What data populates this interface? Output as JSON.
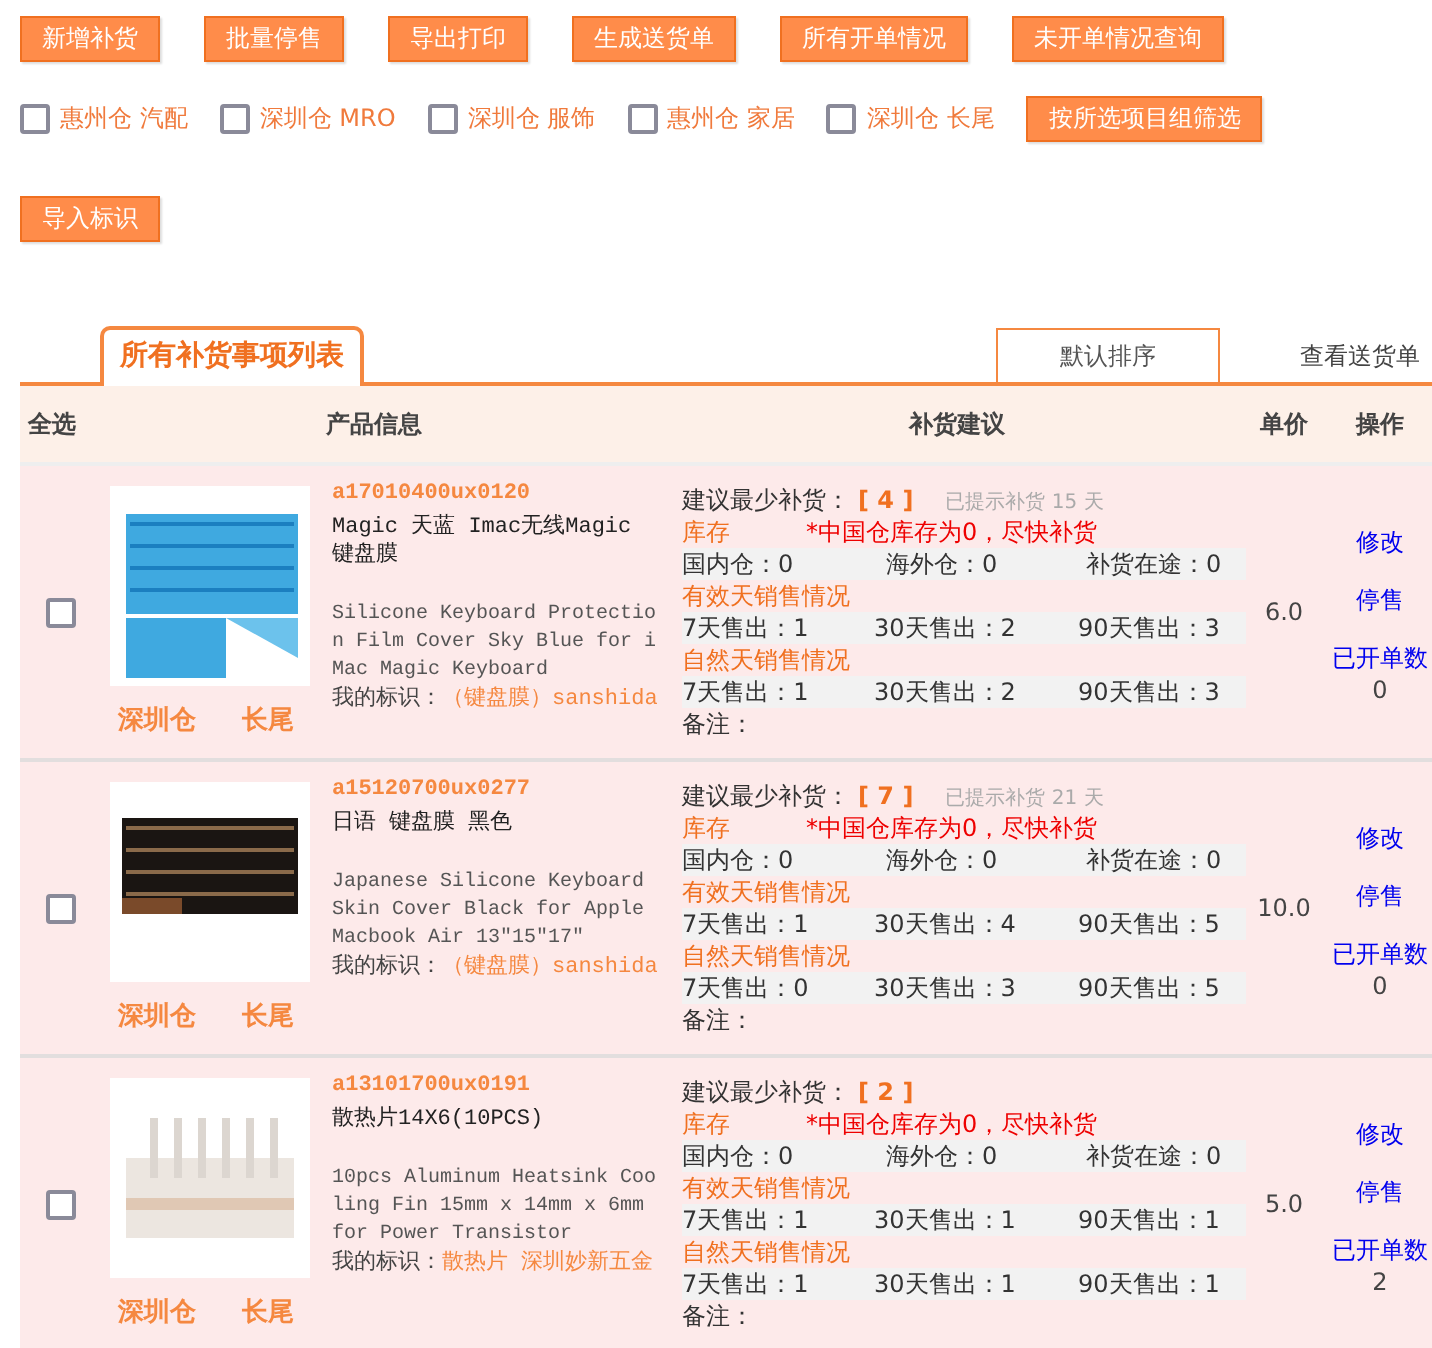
{
  "toolbar": [
    "新增补货",
    "批量停售",
    "导出打印",
    "生成送货单",
    "所有开单情况",
    "未开单情况查询"
  ],
  "filters": [
    {
      "label": "惠州仓 汽配",
      "checked": false
    },
    {
      "label": "深圳仓 MRO",
      "checked": false
    },
    {
      "label": "深圳仓 服饰",
      "checked": false
    },
    {
      "label": "惠州仓 家居",
      "checked": false
    },
    {
      "label": "深圳仓 长尾",
      "checked": false
    }
  ],
  "filter_button": "按所选项目组筛选",
  "import_button": "导入标识",
  "tab": {
    "label": "所有补货事项列表",
    "selected": true
  },
  "sort_button": "默认排序",
  "delivery_link": "查看送货单",
  "columns": [
    "全选",
    "产品信息",
    "补货建议",
    "单价",
    "操作"
  ],
  "rows": [
    {
      "checked": false,
      "warehouse": "深圳仓",
      "group": "长尾",
      "sku": "a17010400ux0120",
      "title": "Magic 天蓝 Imac无线Magic 键盘膜",
      "description": "Silicone Keyboard Protection Film Cover Sky Blue for iMac Magic Keyboard",
      "tag_label": "我的标识：",
      "tag": "（键盘膜）sanshida",
      "suggest_label": "建议最少补货：",
      "suggest_qty": "[ 4 ]",
      "reminder": "已提示补货 15 天",
      "stock_label": "库存",
      "warning": "*中国仓库存为0，尽快补货",
      "stock": [
        "国内仓：0",
        "海外仓：0",
        "补货在途：0"
      ],
      "effective_label": "有效天销售情况",
      "effective": [
        "7天售出：1",
        "30天售出：2",
        "90天售出：3"
      ],
      "natural_label": "自然天销售情况",
      "natural": [
        "7天售出：1",
        "30天售出：2",
        "90天售出：3"
      ],
      "note": "备注：",
      "price": "6.0",
      "actions": [
        "修改",
        "停售",
        "已开单数"
      ],
      "order_count": "0"
    },
    {
      "checked": false,
      "warehouse": "深圳仓",
      "group": "长尾",
      "sku": "a15120700ux0277",
      "title": "日语 键盘膜 黑色",
      "description": "Japanese Silicone Keyboard Skin Cover Black for Apple Macbook Air 13\"15\"17\"",
      "tag_label": "我的标识：",
      "tag": "（键盘膜）sanshida",
      "suggest_label": "建议最少补货：",
      "suggest_qty": "[ 7 ]",
      "reminder": "已提示补货 21 天",
      "stock_label": "库存",
      "warning": "*中国仓库存为0，尽快补货",
      "stock": [
        "国内仓：0",
        "海外仓：0",
        "补货在途：0"
      ],
      "effective_label": "有效天销售情况",
      "effective": [
        "7天售出：1",
        "30天售出：4",
        "90天售出：5"
      ],
      "natural_label": "自然天销售情况",
      "natural": [
        "7天售出：0",
        "30天售出：3",
        "90天售出：5"
      ],
      "note": "备注：",
      "price": "10.0",
      "actions": [
        "修改",
        "停售",
        "已开单数"
      ],
      "order_count": "0"
    },
    {
      "checked": false,
      "warehouse": "深圳仓",
      "group": "长尾",
      "sku": "a13101700ux0191",
      "title": "散热片14X6(10PCS)",
      "description": "10pcs Aluminum Heatsink Cooling Fin 15mm x 14mm x 6mm for Power Transistor",
      "tag_label": "我的标识：",
      "tag": "散热片 深圳妙新五金",
      "suggest_label": "建议最少补货：",
      "suggest_qty": "[ 2 ]",
      "reminder": "",
      "stock_label": "库存",
      "warning": "*中国仓库存为0，尽快补货",
      "stock": [
        "国内仓：0",
        "海外仓：0",
        "补货在途：0"
      ],
      "effective_label": "有效天销售情况",
      "effective": [
        "7天售出：1",
        "30天售出：1",
        "90天售出：1"
      ],
      "natural_label": "自然天销售情况",
      "natural": [
        "7天售出：1",
        "30天售出：1",
        "90天售出：1"
      ],
      "note": "备注：",
      "price": "5.0",
      "actions": [
        "修改",
        "停售",
        "已开单数"
      ],
      "order_count": "2"
    }
  ]
}
